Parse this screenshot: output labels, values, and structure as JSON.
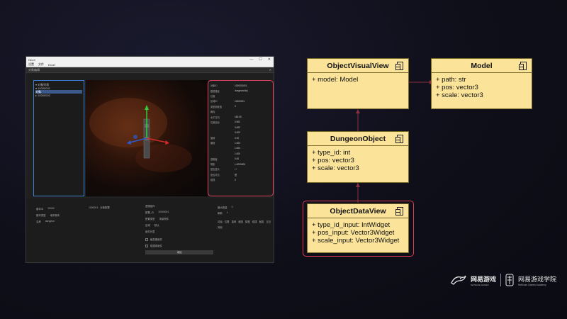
{
  "screenshot": {
    "window_title": "NeoX",
    "window_controls": [
      "—",
      "☐",
      "✕"
    ],
    "menu": [
      "设置",
      "文件",
      "Excel"
    ],
    "toolbar_title": "对象编辑",
    "close_glyph": "✕",
    "tree": [
      "▾ 对象列表",
      "  ▾ 10000001",
      "      对象",
      "    ▸ 10000002"
    ],
    "props": [
      {
        "k": "对象ID",
        "v": "1000001001"
      },
      {
        "k": "模型路径",
        "v": "dungeon/obj/..."
      },
      {
        "k": "位置",
        "v": ""
      },
      {
        "k": "区域ID",
        "v": "10000001"
      },
      {
        "k": "类型参数值",
        "v": "0"
      },
      {
        "k": "朝向",
        "v": ""
      },
      {
        "k": "水平方向",
        "v": "180.00"
      },
      {
        "k": "位置坐标",
        "v": "0.500"
      },
      {
        "k": "",
        "v": "0.000"
      },
      {
        "k": "",
        "v": "0.000"
      },
      {
        "k": "旋转",
        "v": "0.00"
      },
      {
        "k": "缩放",
        "v": "1.000"
      },
      {
        "k": "",
        "v": "1.000"
      },
      {
        "k": "",
        "v": "1.000"
      },
      {
        "k": "透明度",
        "v": "0.00"
      },
      {
        "k": "阴影",
        "v": "1.0000000"
      },
      {
        "k": "是否显示",
        "v": "☐"
      },
      {
        "k": "是否可见",
        "v": "是"
      },
      {
        "k": "碰撞",
        "v": "0"
      }
    ],
    "bottom_info": [
      {
        "k": "副本ID",
        "v": "10000"
      },
      {
        "k": "副本类型",
        "v": "地牢副本"
      },
      {
        "k": "名称",
        "v": "dungeon"
      }
    ],
    "bottom_mid": "1000001 · 对象配置",
    "bottom_desc_title": "逻辑组件",
    "bottom_desc": [
      {
        "k": "配置_ID",
        "v": "10000001"
      },
      {
        "k": "配置类型",
        "v": "场景物件"
      },
      {
        "k": "区域",
        "v": "默认"
      }
    ],
    "bottom_list_title": "组件列表",
    "bottom_checks": [
      "触发器组件",
      "碰撞体组件"
    ],
    "bottom_button": "添加",
    "bottom_right": [
      {
        "k": "最大数量",
        "v": "0"
      },
      {
        "k": "刷新",
        "v": "1"
      }
    ],
    "bottom_tags": [
      "初始",
      "位置",
      "旋转",
      "缩放",
      "模型",
      "碰撞",
      "触发",
      "交互",
      "其他"
    ]
  },
  "diagram": {
    "classes": [
      {
        "id": "ObjectVisualView",
        "title": "ObjectVisualView",
        "members": [
          "+ model: Model"
        ]
      },
      {
        "id": "Model",
        "title": "Model",
        "members": [
          "+ path: str",
          "+ pos: vector3",
          "+ scale: vector3"
        ]
      },
      {
        "id": "DungeonObject",
        "title": "DungeonObject",
        "members": [
          "+ type_id: int",
          "+ pos: vector3",
          "+ scale: vector3"
        ]
      },
      {
        "id": "ObjectDataView",
        "title": "ObjectDataView",
        "members": [
          "+ type_id_input: IntWidget",
          "+ pos_input: Vector3Widget",
          "+ scale_input: Vector3Widget"
        ]
      }
    ],
    "line_color": "#8a3040",
    "highlight_color": "#e03a55",
    "box_color": "#fbe499"
  },
  "logo": {
    "name": "网易游戏",
    "name_sub": "NETEASE GAMES",
    "academy": "网易游戏学院",
    "academy_en": "NetEase Games Academy"
  }
}
